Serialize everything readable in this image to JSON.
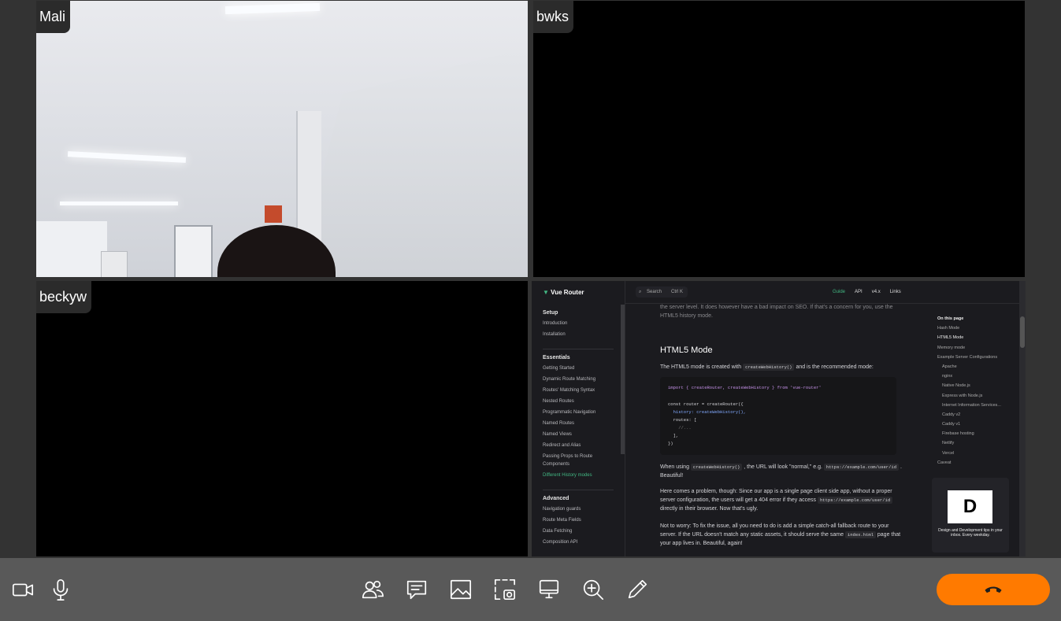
{
  "participants": [
    {
      "name": "Mali"
    },
    {
      "name": "bwks"
    },
    {
      "name": "beckyw"
    }
  ],
  "screen_share": {
    "logo": "Vue Router",
    "search_placeholder": "Search",
    "search_shortcut": "Ctrl K",
    "nav": [
      "Guide",
      "API",
      "v4.x",
      "Links"
    ],
    "sidebar": {
      "setup_title": "Setup",
      "setup_items": [
        "Introduction",
        "Installation"
      ],
      "essentials_title": "Essentials",
      "essentials_items": [
        "Getting Started",
        "Dynamic Route Matching",
        "Routes' Matching Syntax",
        "Nested Routes",
        "Programmatic Navigation",
        "Named Routes",
        "Named Views",
        "Redirect and Alias",
        "Passing Props to Route Components",
        "Different History modes"
      ],
      "advanced_title": "Advanced",
      "advanced_items": [
        "Navigation guards",
        "Route Meta Fields",
        "Data Fetching",
        "Composition API"
      ]
    },
    "content": {
      "intro_tail": "the server level. It does however have a bad impact on SEO. If that's a concern for you, use the HTML5 history mode.",
      "heading": "HTML5 Mode",
      "p1_a": "The HTML5 mode is created with",
      "p1_code": "createWebHistory()",
      "p1_b": "and is the recommended mode:",
      "code_lines": [
        "import { createRouter, createWebHistory } from 'vue-router'",
        "",
        "const router = createRouter({",
        "  history: createWebHistory(),",
        "  routes: [",
        "    //...",
        "  ],",
        "})"
      ],
      "p2_a": "When using",
      "p2_code": "createWebHistory()",
      "p2_b": ", the URL will look \"normal,\" e.g.",
      "p2_url": "https://example.com/user/id",
      "p2_c": ". Beautiful!",
      "p3_a": "Here comes a problem, though: Since our app is a single page client side app, without a proper server configuration, the users will get a 404 error if they access",
      "p3_url": "https://example.com/user/id",
      "p3_b": "directly in their browser. Now that's ugly.",
      "p4_a": "Not to worry: To fix the issue, all you need to do is add a simple catch-all fallback route to your server. If the URL doesn't match any static assets, it should serve the same",
      "p4_code": "index.html",
      "p4_b": "page that your app lives in. Beautiful, again!"
    },
    "toc": {
      "title": "On this page",
      "items": [
        "Hash Mode",
        "HTML5 Mode",
        "Memory mode",
        "Example Server Configurations",
        "Apache",
        "nginx",
        "Native Node.js",
        "Express with Node.js",
        "Internet Information Services...",
        "Caddy v2",
        "Caddy v1",
        "Firebase hosting",
        "Netlify",
        "Vercel",
        "Caveat"
      ],
      "active": "HTML5 Mode"
    },
    "ad": {
      "logo_text": "D",
      "text": "Design and Development tips in your inbox. Every weekday."
    }
  },
  "toolbar": {
    "left": [
      "camera-icon",
      "microphone-icon"
    ],
    "center": [
      "participants-icon",
      "chat-icon",
      "image-icon",
      "screenshot-icon",
      "screen-share-icon",
      "zoom-icon",
      "annotate-icon"
    ],
    "end_call": "end-call-icon",
    "end_call_color": "#ff7a00"
  }
}
